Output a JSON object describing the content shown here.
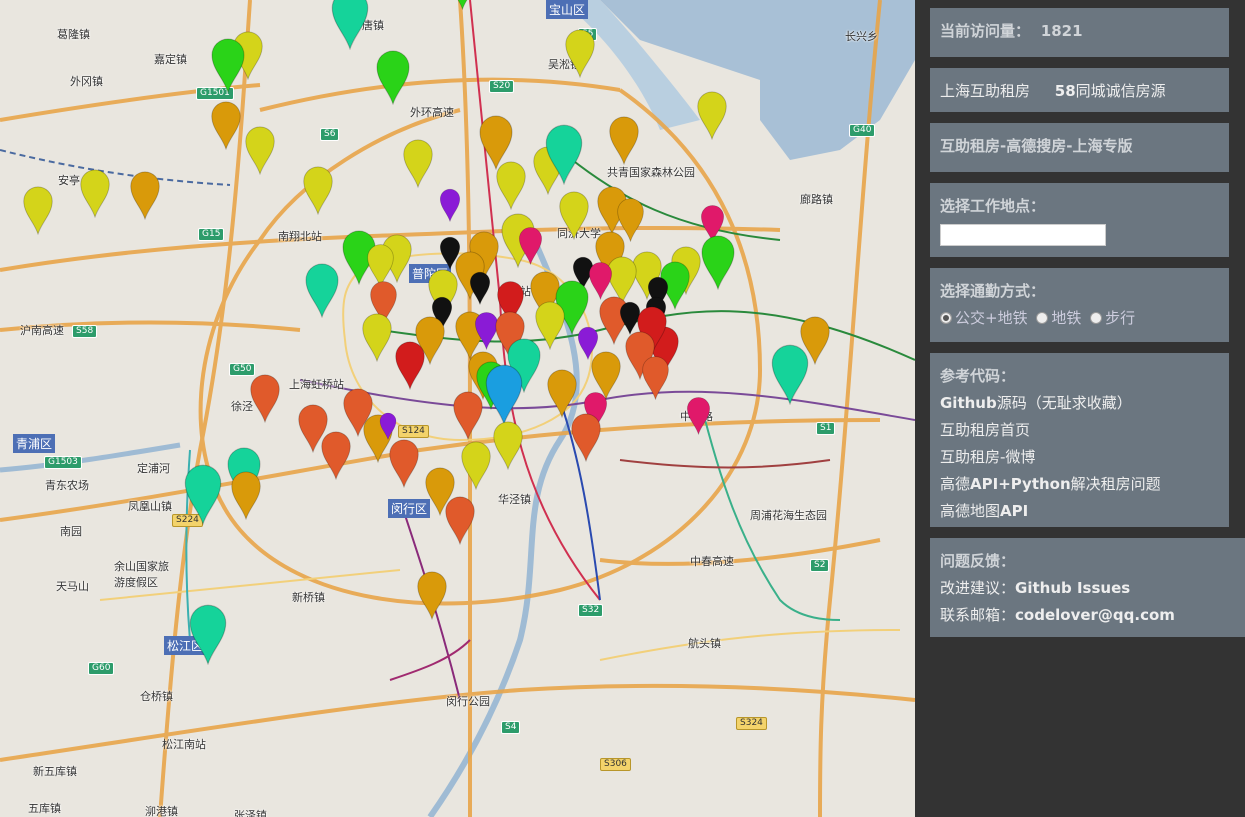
{
  "map": {
    "districts": [
      "宝山区",
      "普陀区",
      "青浦区",
      "闵行区",
      "松江区"
    ],
    "places": [
      "葛隆镇",
      "嘉定镇",
      "外冈镇",
      "吴淞镇",
      "长兴乡",
      "共青国家森林公园",
      "同济大学",
      "上海站",
      "南翔北站",
      "安亭",
      "上海虹桥站",
      "徐泾",
      "青东农场",
      "凤凰山镇",
      "南园",
      "余山国家旅游度假区",
      "天马山",
      "新桥镇",
      "华泾镇",
      "周浦花海生态园",
      "航头镇",
      "仓桥镇",
      "闵行公园",
      "松江南站",
      "新五库镇",
      "五库镇",
      "泖港镇",
      "张泽镇",
      "廊路镇",
      "唐镇",
      "沪南高速",
      "中环路",
      "外环高速",
      "定浦河",
      "中春高速"
    ],
    "shields": [
      "G1501",
      "G15",
      "S6",
      "S20",
      "S5",
      "G40",
      "S58",
      "G50",
      "S124",
      "S32",
      "S4",
      "S324",
      "S306",
      "G60",
      "S1",
      "S2",
      "G1503",
      "S224"
    ]
  },
  "panel": {
    "visits_label": "当前访问量：",
    "visits_count": "1821",
    "source_prefix": "上海互助租房",
    "source_num": "58",
    "source_suffix": "同城诚信房源",
    "edition": "互助租房-高德搜房-上海专版",
    "work_label": "选择工作地点：",
    "work_value": "",
    "commute_label": "选择通勤方式：",
    "commute_options": [
      "公交+地铁",
      "地铁",
      "步行"
    ],
    "commute_selected": "公交+地铁",
    "ref_label": "参考代码：",
    "ref_github_bold": "Github",
    "ref_github_rest": "源码（无耻求收藏）",
    "ref_home": "互助租房首页",
    "ref_weibo": "互助租房-微博",
    "ref_amap_prefix": "高德",
    "ref_amap_bold": "API+Python",
    "ref_amap_suffix": "解决租房问题",
    "ref_map_prefix": "高德地图",
    "ref_map_bold": "API",
    "feedback_label": "问题反馈：",
    "suggest_label": "改进建议：",
    "suggest_value": "Github Issues",
    "email_label": "联系邮箱：",
    "email_value": "codelover@qq.com"
  },
  "colors": {
    "panel_bg": "#333333",
    "box_bg": "#6b7680",
    "marker_yellow": "#d4d41a",
    "marker_orange": "#d99a0a",
    "marker_green": "#2ad318",
    "marker_teal": "#15d39a",
    "marker_red": "#d21c1c",
    "marker_redorange": "#e05a2b",
    "marker_black": "#111111",
    "marker_purple": "#8a1bd6",
    "marker_pink": "#e0196a",
    "marker_blue": "#1a9ee0"
  }
}
